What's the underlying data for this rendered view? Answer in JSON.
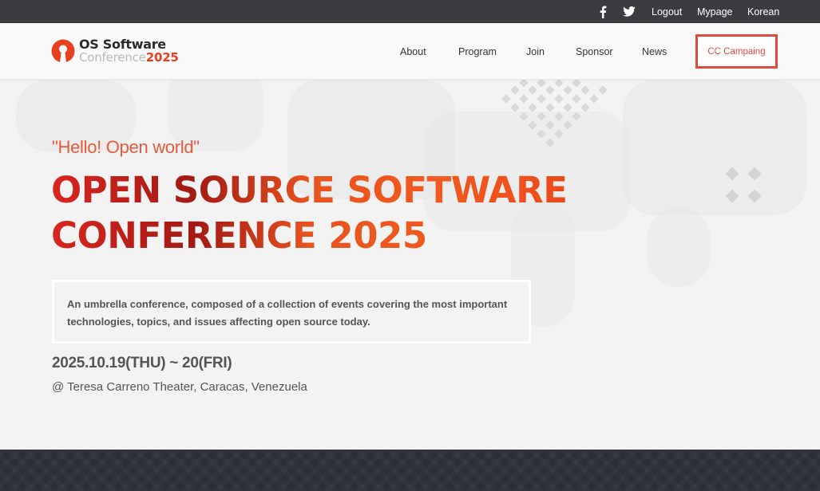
{
  "topbar": {
    "facebook_icon": "facebook-icon",
    "twitter_icon": "twitter-icon",
    "logout": "Logout",
    "mypage": "Mypage",
    "language": "Korean"
  },
  "logo": {
    "line1": "OS Software",
    "line2": "Conference",
    "year": "2025"
  },
  "nav": {
    "items": [
      "About",
      "Program",
      "Join",
      "Sponsor",
      "News"
    ],
    "cta": "CC Campaing"
  },
  "hero": {
    "tagline": "\"Hello! Open world\"",
    "headline_line1": "OPEN SOURCE SOFTWARE",
    "headline_line2": "CONFERENCE 2025",
    "description": "An umbrella conference, composed of a collection of events covering the most important technologies, topics, and issues affecting open source today.",
    "dates": "2025.10.19(THU) ~ 20(FRI)",
    "venue": "@ Teresa Carreno Theater, Caracas, Venezuela"
  },
  "colors": {
    "accent": "#e04a3c",
    "topbar_bg": "#3b3c40",
    "footer_bg": "#2c2e3a"
  }
}
